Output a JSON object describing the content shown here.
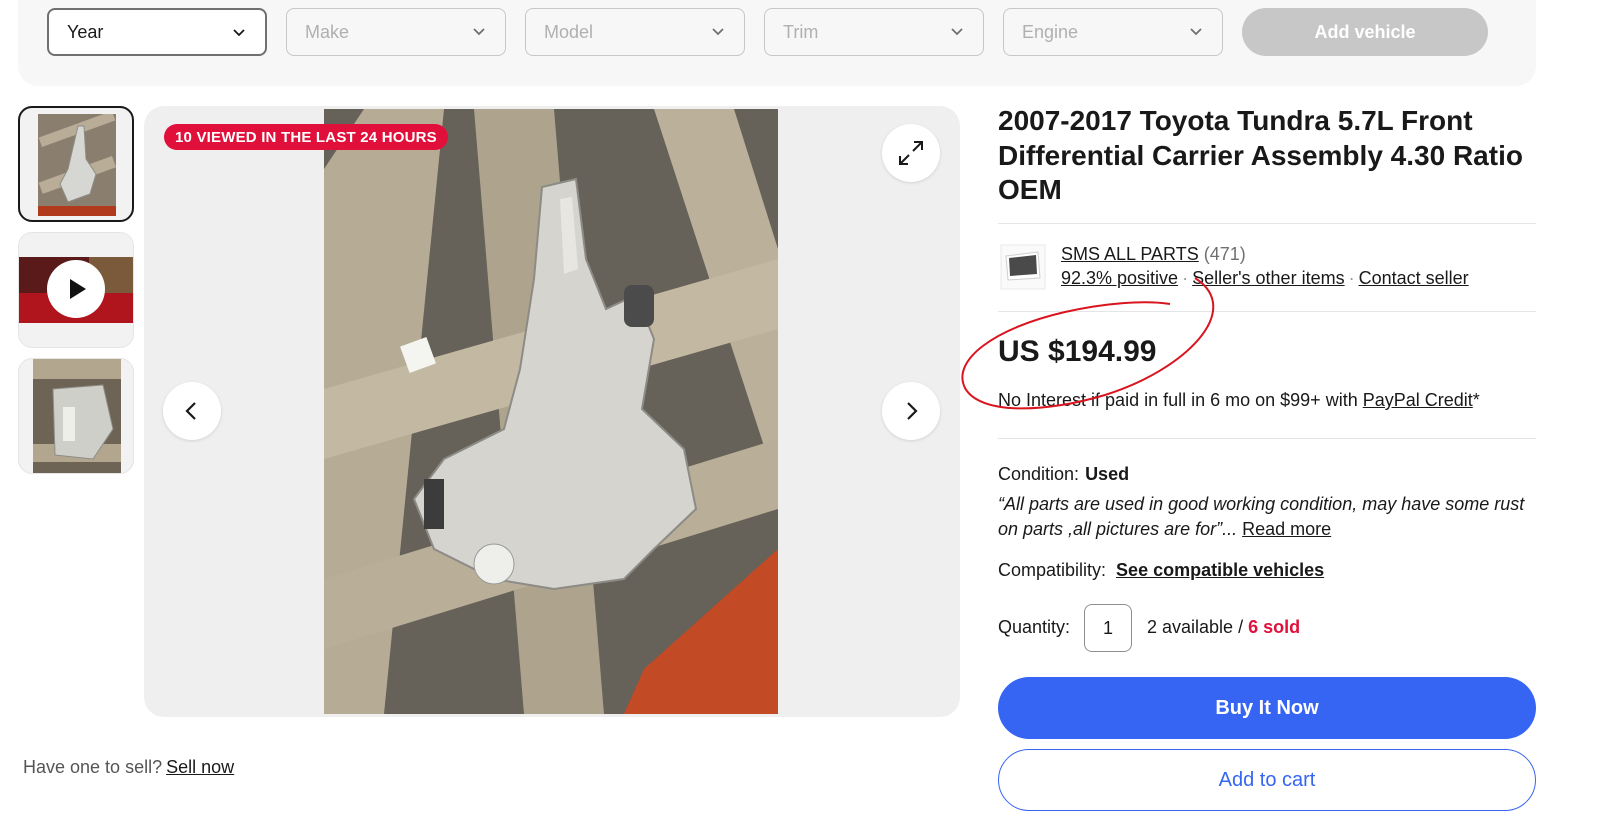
{
  "vehicle_selector": {
    "year": "Year",
    "make": "Make",
    "model": "Model",
    "trim": "Trim",
    "engine": "Engine",
    "add_vehicle": "Add vehicle"
  },
  "gallery": {
    "badge": "10 VIEWED IN THE LAST 24 HOURS",
    "thumbnails": [
      "photo",
      "video",
      "photo"
    ]
  },
  "sell": {
    "prompt": "Have one to sell?",
    "link": "Sell now"
  },
  "listing": {
    "title": "2007-2017 Toyota Tundra 5.7L Front Differential Carrier Assembly 4.30 Ratio OEM",
    "seller": {
      "name": "SMS ALL PARTS",
      "feedback_count": "(471)",
      "positive": "92.3% positive",
      "other_items": "Seller's other items",
      "contact": "Contact seller"
    },
    "price": "US $194.99",
    "financing_text": "No Interest if paid in full in 6 mo on $99+ with",
    "financing_link": "PayPal Credit",
    "financing_suffix": "*",
    "condition_label": "Condition:",
    "condition_value": "Used",
    "condition_quote": "“All parts are used in good working condition, may have some rust on parts ,all pictures are for”...",
    "read_more": "Read more",
    "compat_label": "Compatibility:",
    "compat_link": "See compatible vehicles",
    "quantity_label": "Quantity:",
    "quantity_value": "1",
    "available": "2 available /",
    "sold": "6 sold",
    "buy_now": "Buy It Now",
    "add_to_cart": "Add to cart"
  },
  "colors": {
    "primary": "#3665f3",
    "badge": "#e0103a",
    "annotation": "#d9141f"
  }
}
